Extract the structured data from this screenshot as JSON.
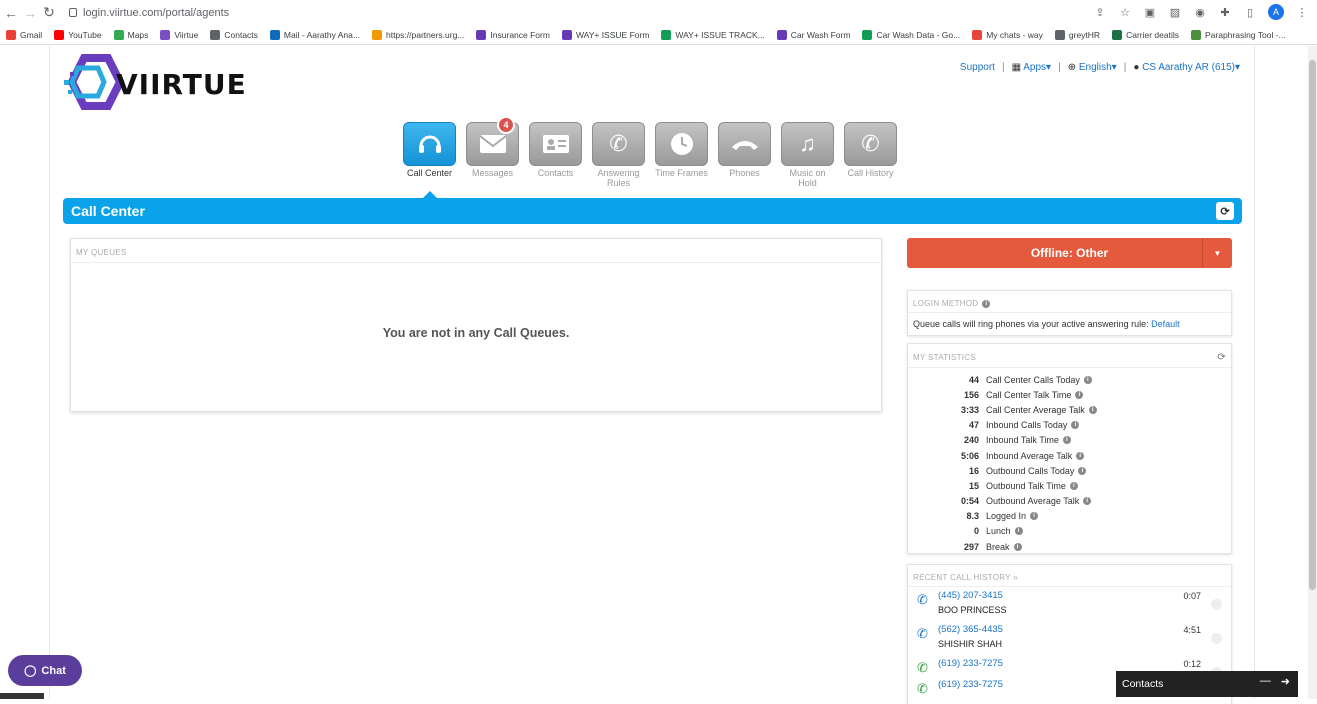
{
  "browser": {
    "url": "login.viirtue.com/portal/agents",
    "profile_initial": "A",
    "bookmarks": [
      {
        "label": "Gmail",
        "color": "#ea4335"
      },
      {
        "label": "YouTube",
        "color": "#ff0000"
      },
      {
        "label": "Maps",
        "color": "#34a853"
      },
      {
        "label": "Viirtue",
        "color": "#7b4fc4"
      },
      {
        "label": "Contacts",
        "color": "#5f6368"
      },
      {
        "label": "Mail - Aarathy Ana...",
        "color": "#0f6cbd"
      },
      {
        "label": "https://partners.urg...",
        "color": "#f29900"
      },
      {
        "label": "Insurance Form",
        "color": "#673ab7"
      },
      {
        "label": "WAY+ ISSUE Form",
        "color": "#673ab7"
      },
      {
        "label": "WAY+ ISSUE TRACK...",
        "color": "#0f9d58"
      },
      {
        "label": "Car Wash Form",
        "color": "#673ab7"
      },
      {
        "label": "Car Wash Data - Go...",
        "color": "#0f9d58"
      },
      {
        "label": "My chats - way",
        "color": "#e8453c"
      },
      {
        "label": "greytHR",
        "color": "#5f6368"
      },
      {
        "label": "Carrier deatils",
        "color": "#1e7145"
      },
      {
        "label": "Paraphrasing Tool -...",
        "color": "#4a8f3c"
      }
    ]
  },
  "header": {
    "logo_text": "VIIRTUE",
    "support": "Support",
    "apps": "Apps",
    "language": "English",
    "user": "CS Aarathy AR (615)"
  },
  "tabs": [
    {
      "label": "Call Center",
      "icon": "headset-icon"
    },
    {
      "label": "Messages",
      "icon": "envelope-icon",
      "badge": "4"
    },
    {
      "label": "Contacts",
      "icon": "contact-card-icon"
    },
    {
      "label": "Answering Rules",
      "icon": "phone-rules-icon"
    },
    {
      "label": "Time Frames",
      "icon": "clock-icon"
    },
    {
      "label": "Phones",
      "icon": "handset-icon"
    },
    {
      "label": "Music on Hold",
      "icon": "music-note-icon"
    },
    {
      "label": "Call History",
      "icon": "call-history-icon"
    }
  ],
  "banner": {
    "title": "Call Center"
  },
  "queues": {
    "heading": "MY QUEUES",
    "empty": "You are not in any Call Queues."
  },
  "status": {
    "label": "Offline: Other",
    "color": "#e55a3d"
  },
  "login_method": {
    "heading": "LOGIN METHOD",
    "text": "Queue calls will ring phones via your active answering rule:",
    "link": "Default"
  },
  "stats": {
    "heading": "MY STATISTICS",
    "rows": [
      {
        "value": "44",
        "label": "Call Center Calls Today"
      },
      {
        "value": "156",
        "label": "Call Center Talk Time"
      },
      {
        "value": "3:33",
        "label": "Call Center Average Talk"
      },
      {
        "value": "47",
        "label": "Inbound Calls Today"
      },
      {
        "value": "240",
        "label": "Inbound Talk Time"
      },
      {
        "value": "5:06",
        "label": "Inbound Average Talk"
      },
      {
        "value": "16",
        "label": "Outbound Calls Today"
      },
      {
        "value": "15",
        "label": "Outbound Talk Time"
      },
      {
        "value": "0:54",
        "label": "Outbound Average Talk"
      },
      {
        "value": "8.3",
        "label": "Logged In"
      },
      {
        "value": "0",
        "label": "Lunch"
      },
      {
        "value": "297",
        "label": "Break"
      }
    ]
  },
  "recent_calls": {
    "heading": "RECENT CALL HISTORY »",
    "rows": [
      {
        "number": "(445) 207-3415",
        "name": "BOO PRINCESS",
        "duration": "0:07",
        "direction": "inbound",
        "color": "#1a73c7"
      },
      {
        "number": "(562) 365-4435",
        "name": "SHISHIR SHAH",
        "duration": "4:51",
        "direction": "inbound",
        "color": "#1a73c7"
      },
      {
        "number": "(619) 233-7275",
        "name": "",
        "duration": "0:12",
        "direction": "outbound",
        "color": "#2e9e3e"
      },
      {
        "number": "(619) 233-7275",
        "name": "",
        "duration": "",
        "direction": "outbound",
        "color": "#2e9e3e"
      }
    ]
  },
  "chat": {
    "label": "Chat"
  },
  "contacts_bar": {
    "label": "Contacts"
  }
}
